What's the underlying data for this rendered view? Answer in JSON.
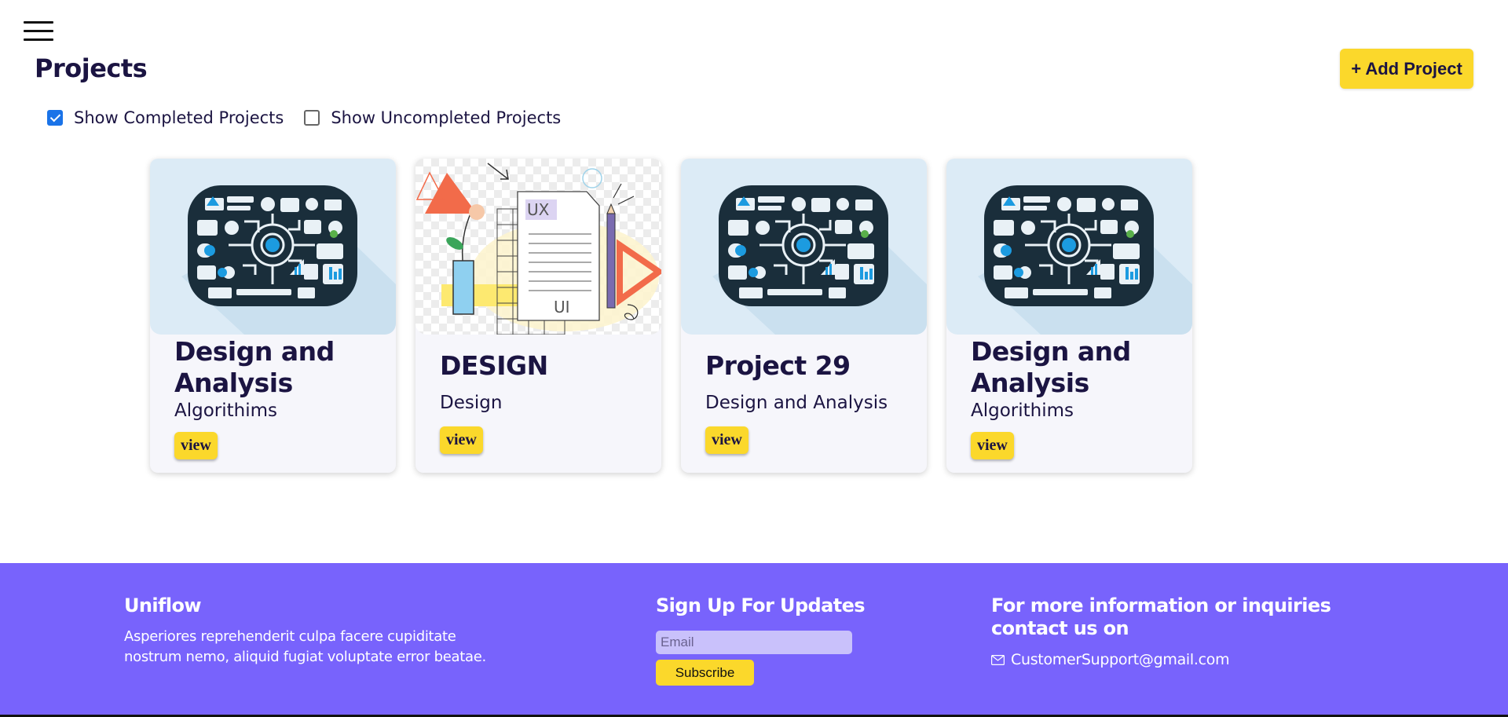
{
  "header": {
    "menu_icon": "hamburger-menu-icon",
    "title": "Projects",
    "add_button": "+ Add Project"
  },
  "filters": {
    "completed": {
      "label": "Show Completed Projects",
      "checked": true
    },
    "uncompleted": {
      "label": "Show Uncompleted Projects",
      "checked": false
    }
  },
  "projects": [
    {
      "title": "Design and Analysis",
      "subtitle": "Algorithims",
      "button": "view",
      "image": "algorithm-illustration"
    },
    {
      "title": "DESIGN",
      "subtitle": "Design",
      "button": "view",
      "image": "ux-ui-illustration"
    },
    {
      "title": "Project 29",
      "subtitle": "Design and Analysis",
      "button": "view",
      "image": "algorithm-illustration"
    },
    {
      "title": "Design and Analysis",
      "subtitle": "Algorithims",
      "button": "view",
      "image": "algorithm-illustration"
    }
  ],
  "ux_image_labels": {
    "top": "UX",
    "bottom": "UI"
  },
  "footer": {
    "brand": "Uniflow",
    "description": "Asperiores reprehenderit culpa facere cupiditate nostrum nemo, aliquid fugiat voluptate error beatae.",
    "signup_heading": "Sign Up For Updates",
    "email_placeholder": "Email",
    "subscribe_label": "Subscribe",
    "contact_heading": "For more information or inquiries contact us on",
    "contact_email": "CustomerSupport@gmail.com",
    "contact_icon": "mail-icon"
  },
  "colors": {
    "accent": "#fbd82b",
    "footer_bg": "#7863fc",
    "text": "#1b1442",
    "checkbox": "#1a73e8"
  }
}
